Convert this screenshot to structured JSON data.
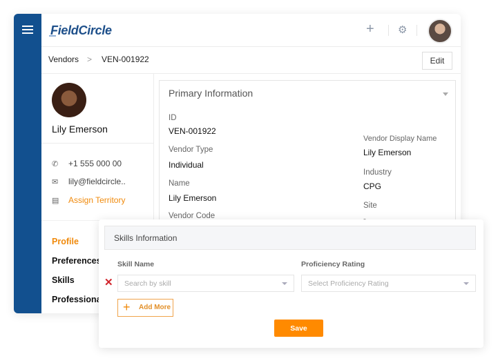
{
  "app": {
    "brand": "FieldCircle",
    "colors": {
      "rail": "#12508f",
      "accent": "#f08a0c",
      "danger": "#d0242b"
    }
  },
  "topbar": {
    "icons": [
      "menu-icon",
      "plus-icon",
      "gear-icon",
      "user-avatar"
    ]
  },
  "breadcrumb": {
    "parent": "Vendors",
    "separator": ">",
    "current": "VEN-001922"
  },
  "actions": {
    "edit_label": "Edit"
  },
  "profile": {
    "name": "Lily Emerson",
    "phone": "+1 555 000 00",
    "email": "lily@fieldcircle..",
    "assign_territory": "Assign Territory"
  },
  "nav": {
    "items": [
      {
        "label": "Profile",
        "active": true
      },
      {
        "label": "Preferences",
        "active": false
      },
      {
        "label": "Skills",
        "active": false
      },
      {
        "label": "Professiona",
        "active": false
      }
    ]
  },
  "primary": {
    "title": "Primary Information",
    "left_fields": [
      {
        "label": "ID",
        "value": "VEN-001922"
      },
      {
        "label": "Vendor Type",
        "value": "Individual"
      },
      {
        "label": "Name",
        "value": "Lily Emerson"
      },
      {
        "label": "Vendor Code",
        "value": ""
      }
    ],
    "right_fields": [
      {
        "label": "Vendor Display Name",
        "value": "Lily Emerson"
      },
      {
        "label": "Industry",
        "value": "CPG"
      },
      {
        "label": "Site",
        "value": "-"
      }
    ]
  },
  "skills": {
    "title": "Skills Information",
    "skill_name_label": "Skill Name",
    "skill_placeholder": "Search by skill",
    "proficiency_label": "Proficiency Rating",
    "proficiency_placeholder": "Select Proficiency Rating",
    "remove_symbol": "✕",
    "add_more_label": "Add More",
    "save_label": "Save"
  }
}
